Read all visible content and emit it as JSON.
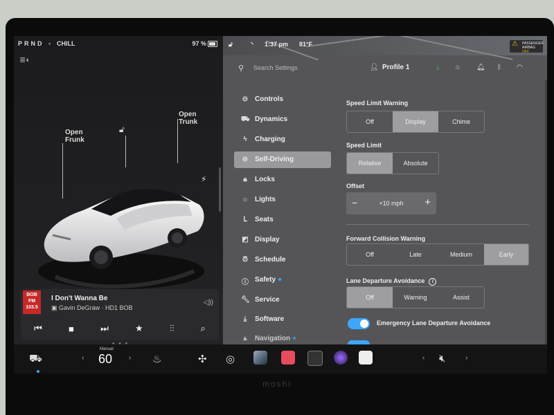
{
  "left_panel": {
    "gear": "PRND",
    "gear_dot": "•",
    "drive_mode": "CHILL",
    "battery": "97 %",
    "callouts": {
      "frunk": "Open\nFrunk",
      "trunk": "Open\nTrunk"
    },
    "media": {
      "station_logo": "BOB FM 103.5",
      "song": "I Don't Wanna Be",
      "artist": "Gavin DeGraw · HD1 BOB"
    }
  },
  "top_status": {
    "time": "1:37 pm",
    "temperature": "81°F",
    "airbag_line1": "PASSENGER",
    "airbag_line2": "AIRBAG",
    "airbag_state": "OFF"
  },
  "search": {
    "placeholder": "Search Settings"
  },
  "profile": {
    "label": "Profile 1"
  },
  "menu": {
    "items": [
      {
        "label": "Controls",
        "icon": "toggle-icon"
      },
      {
        "label": "Dynamics",
        "icon": "car-icon"
      },
      {
        "label": "Charging",
        "icon": "bolt-icon"
      },
      {
        "label": "Self-Driving",
        "icon": "steering-wheel-icon",
        "active": true
      },
      {
        "label": "Locks",
        "icon": "lock-icon"
      },
      {
        "label": "Lights",
        "icon": "sun-icon"
      },
      {
        "label": "Seats",
        "icon": "seat-icon"
      },
      {
        "label": "Display",
        "icon": "display-icon"
      },
      {
        "label": "Schedule",
        "icon": "alarm-icon"
      },
      {
        "label": "Safety",
        "icon": "info-icon"
      },
      {
        "label": "Service",
        "icon": "wrench-icon"
      },
      {
        "label": "Software",
        "icon": "download-icon"
      },
      {
        "label": "Navigation",
        "icon": "navigation-icon"
      }
    ]
  },
  "settings": {
    "speed_limit_warning": {
      "label": "Speed Limit Warning",
      "options": [
        "Off",
        "Display",
        "Chime"
      ],
      "selected": "Display"
    },
    "speed_limit": {
      "label": "Speed Limit",
      "options": [
        "Relative",
        "Absolute"
      ],
      "selected": "Relative"
    },
    "offset": {
      "label": "Offset",
      "minus": "−",
      "value": "+10 mph",
      "plus": "+"
    },
    "forward_collision": {
      "label": "Forward Collision Warning",
      "options": [
        "Off",
        "Late",
        "Medium",
        "Early"
      ],
      "selected": "Early"
    },
    "lane_departure": {
      "label": "Lane Departure Avoidance",
      "info": "i",
      "options": [
        "Off",
        "Warning",
        "Assist"
      ],
      "selected": "Off"
    },
    "emergency_lane": {
      "label": "Emergency Lane Departure Avoidance",
      "enabled": true
    }
  },
  "dock": {
    "temp_mode": "Manual",
    "temperature": "60",
    "left_arrow": "‹",
    "right_arrow": "›"
  },
  "colors": {
    "accent": "#3ea6ff",
    "airbag": "#f0b400",
    "radio_logo": "#c62828"
  }
}
